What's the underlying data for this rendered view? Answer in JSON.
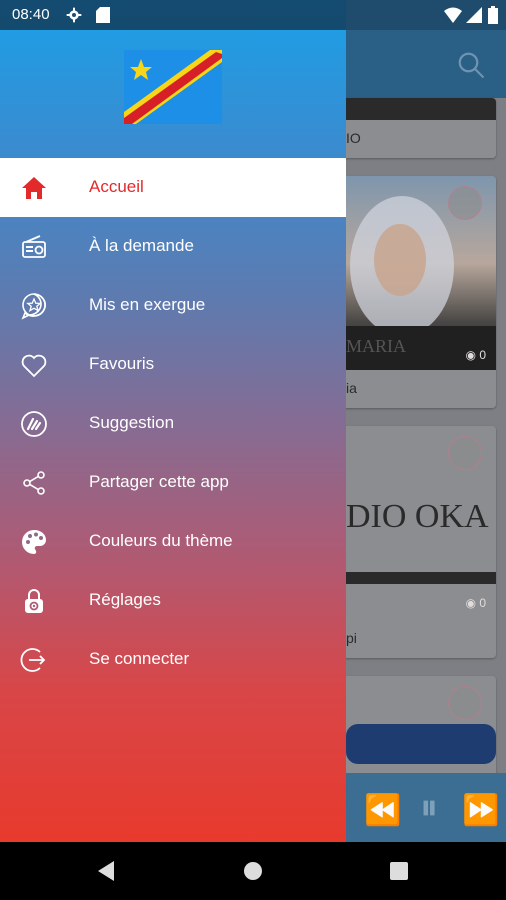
{
  "status_bar": {
    "time": "08:40",
    "icons": [
      "gear-icon",
      "sd-card-icon",
      "wifi-icon",
      "signal-icon",
      "battery-icon"
    ]
  },
  "drawer": {
    "header": {
      "logo": "drc-flag"
    },
    "menu": [
      {
        "label": "Accueil",
        "icon": "home-icon",
        "active": true
      },
      {
        "label": "À la demande",
        "icon": "radio-icon",
        "active": false
      },
      {
        "label": "Mis en exergue",
        "icon": "star-badge-icon",
        "active": false
      },
      {
        "label": "Favouris",
        "icon": "heart-icon",
        "active": false
      },
      {
        "label": "Suggestion",
        "icon": "suggestion-icon",
        "active": false
      },
      {
        "label": "Partager cette app",
        "icon": "share-icon",
        "active": false
      },
      {
        "label": "Couleurs du thème",
        "icon": "palette-icon",
        "active": false
      },
      {
        "label": "Réglages",
        "icon": "settings-lock-icon",
        "active": false
      },
      {
        "label": "Se connecter",
        "icon": "login-icon",
        "active": false
      }
    ]
  },
  "background_app": {
    "cards": [
      {
        "caption": "IO",
        "views": ""
      },
      {
        "caption": "ia",
        "views": "0",
        "image_text": "MARIA"
      },
      {
        "caption": "pi",
        "views": "0",
        "image_text": "DIO OKA"
      },
      {
        "caption": "",
        "views": ""
      }
    ]
  },
  "colors": {
    "active_accent": "#e32a2a",
    "drawer_top": "#1aa0e8",
    "drawer_bottom": "#e83a2d"
  }
}
